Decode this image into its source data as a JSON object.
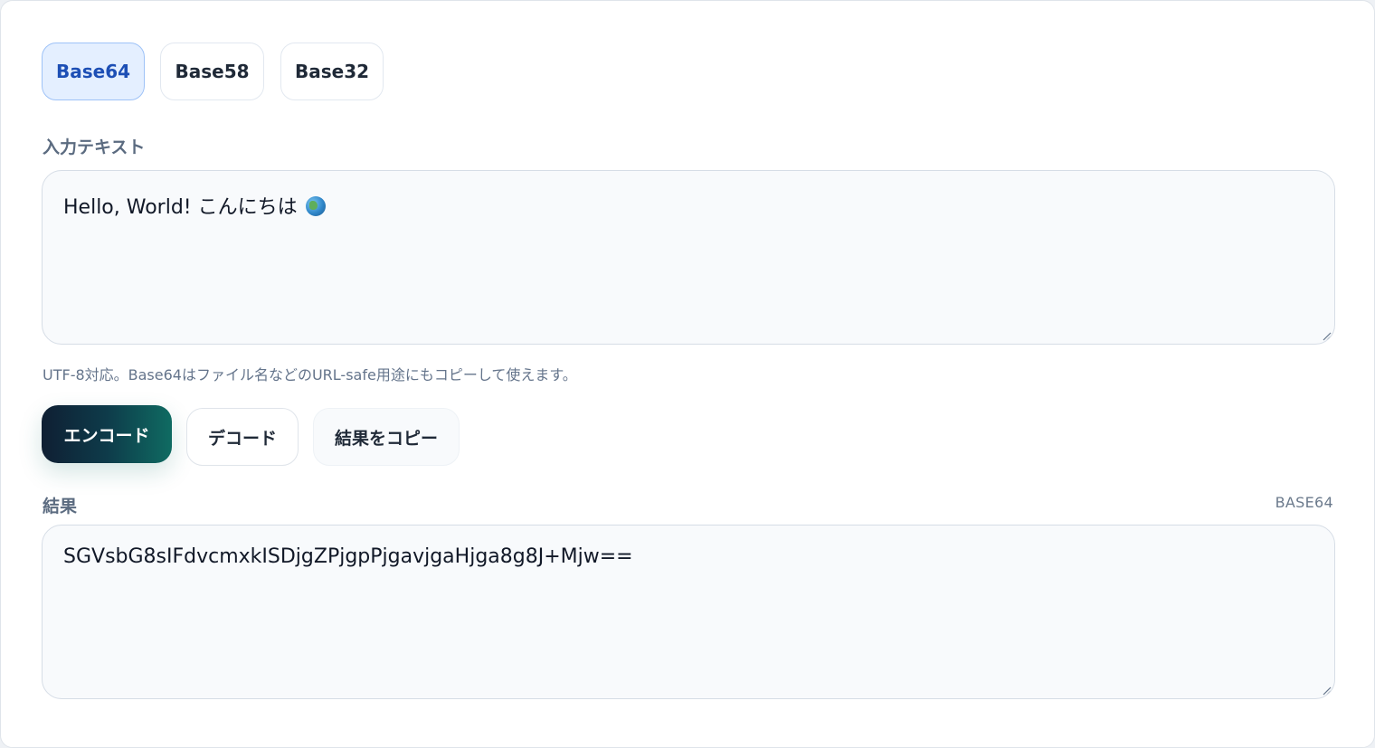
{
  "tabs": [
    {
      "label": "Base64",
      "active": true
    },
    {
      "label": "Base58",
      "active": false
    },
    {
      "label": "Base32",
      "active": false
    }
  ],
  "input": {
    "label": "入力テキスト",
    "value": "Hello, World! こんにちは",
    "emoji_icon": "globe-icon"
  },
  "hint": "UTF-8対応。Base64はファイル名などのURL-safe用途にもコピーして使えます。",
  "actions": {
    "encode_label": "エンコード",
    "decode_label": "デコード",
    "copy_label": "結果をコピー"
  },
  "result": {
    "label": "結果",
    "format": "BASE64",
    "value": "SGVsbG8sIFdvcmxkISDjgZPjgpPjgavjgaHjga8g8J+Mjw=="
  },
  "colors": {
    "accent": "#1d4fb5",
    "tab_active_bg": "#e4efff",
    "primary_start": "#0f1f33",
    "primary_end": "#0f6b62"
  }
}
